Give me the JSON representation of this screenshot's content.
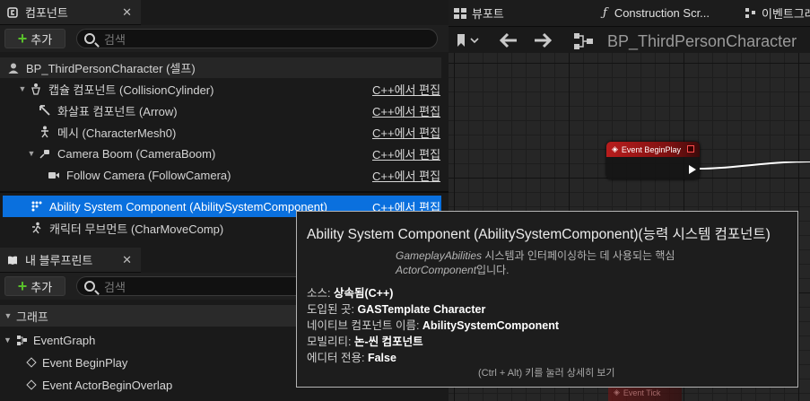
{
  "components_panel": {
    "tab_title": "컴포넌트",
    "add_label": "추가",
    "search_placeholder": "검색",
    "root_item": "BP_ThirdPersonCharacter (셀프)",
    "edit_cpp_label": "C++에서 편집",
    "items": [
      {
        "label": "캡슐 컴포넌트 (CollisionCylinder)",
        "icon": "capsule-icon"
      },
      {
        "label": "화살표 컴포넌트 (Arrow)",
        "icon": "arrow-icon"
      },
      {
        "label": "메시 (CharacterMesh0)",
        "icon": "mesh-icon"
      },
      {
        "label": "Camera Boom (CameraBoom)",
        "icon": "spring-arm-icon"
      },
      {
        "label": "Follow Camera (FollowCamera)",
        "icon": "camera-icon"
      },
      {
        "label": "Ability System Component (AbilitySystemComponent)",
        "icon": "component-icon",
        "selected": true
      },
      {
        "label": "캐릭터 무브먼트 (CharMoveComp)",
        "icon": "movement-icon"
      }
    ]
  },
  "blueprint_panel": {
    "tab_title": "내 블루프린트",
    "add_label": "추가",
    "search_placeholder": "검색",
    "section_graph": "그래프",
    "graph_name": "EventGraph",
    "events": [
      "Event BeginPlay",
      "Event ActorBeginOverlap"
    ]
  },
  "editor_tabs": {
    "viewport": "뷰포트",
    "construction": "Construction Scr...",
    "event_graph": "이벤트그래"
  },
  "graph": {
    "breadcrumb": "BP_ThirdPersonCharacter",
    "node_begin_play": "Event BeginPlay",
    "node_tick": "Event Tick"
  },
  "tooltip": {
    "title": "Ability System Component (AbilitySystemComponent)(능력 시스템 컴포넌트)",
    "desc_italic_1": "GameplayAbilities",
    "desc_text_1": " 시스템과 인터페이싱하는 데 사용되는 핵심 ",
    "desc_italic_2": "ActorComponent",
    "desc_text_2": "입니다.",
    "source_label": "소스:",
    "source_value": "상속됨(C++)",
    "introduced_label": "도입된 곳:",
    "introduced_value": "GASTemplate Character",
    "native_label": "네이티브 컴포넌트 이름:",
    "native_value": "AbilitySystemComponent",
    "mobility_label": "모빌리티:",
    "mobility_value": "논-씬 컴포넌트",
    "editor_only_label": "에디터 전용:",
    "editor_only_value": "False",
    "hint": "(Ctrl + Alt) 키를 눌러 상세히 보기"
  },
  "colors": {
    "selection": "#0a70de",
    "add_plus": "#59c02b",
    "event_node": "#b91d1d"
  }
}
